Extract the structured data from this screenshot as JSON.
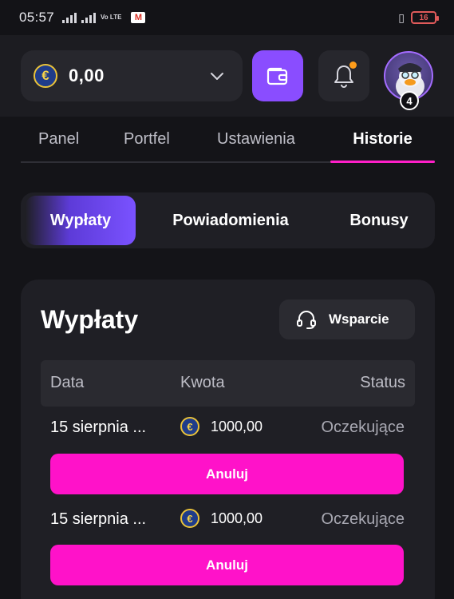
{
  "status_bar": {
    "time": "05:57",
    "volte": "Vo LTE",
    "lte": "LTE",
    "gmail": "M",
    "battery": "16"
  },
  "header": {
    "currency_symbol": "€",
    "balance": "0,00",
    "avatar_level": "4",
    "colors": {
      "wallet_button": "#8a4dff",
      "notification_dot": "#ff9d1a"
    }
  },
  "main_tabs": [
    {
      "label": "Panel",
      "active": false
    },
    {
      "label": "Portfel",
      "active": false
    },
    {
      "label": "Ustawienia",
      "active": false
    },
    {
      "label": "Historie",
      "active": true
    }
  ],
  "sub_tabs": [
    {
      "label": "Wypłaty",
      "active": true
    },
    {
      "label": "Powiadomienia",
      "active": false
    },
    {
      "label": "Bonusy",
      "active": false
    }
  ],
  "panel": {
    "title": "Wypłaty",
    "support_label": "Wsparcie",
    "columns": [
      "Data",
      "Kwota",
      "Status"
    ],
    "rows": [
      {
        "date": "15 sierpnia ...",
        "currency": "€",
        "amount": "1000,00",
        "status": "Oczekujące",
        "action": "Anuluj"
      },
      {
        "date": "15 sierpnia ...",
        "currency": "€",
        "amount": "1000,00",
        "status": "Oczekujące",
        "action": "Anuluj"
      }
    ],
    "colors": {
      "cancel_button": "#ff12c9",
      "active_tab_underline": "#ff1fc8"
    }
  }
}
